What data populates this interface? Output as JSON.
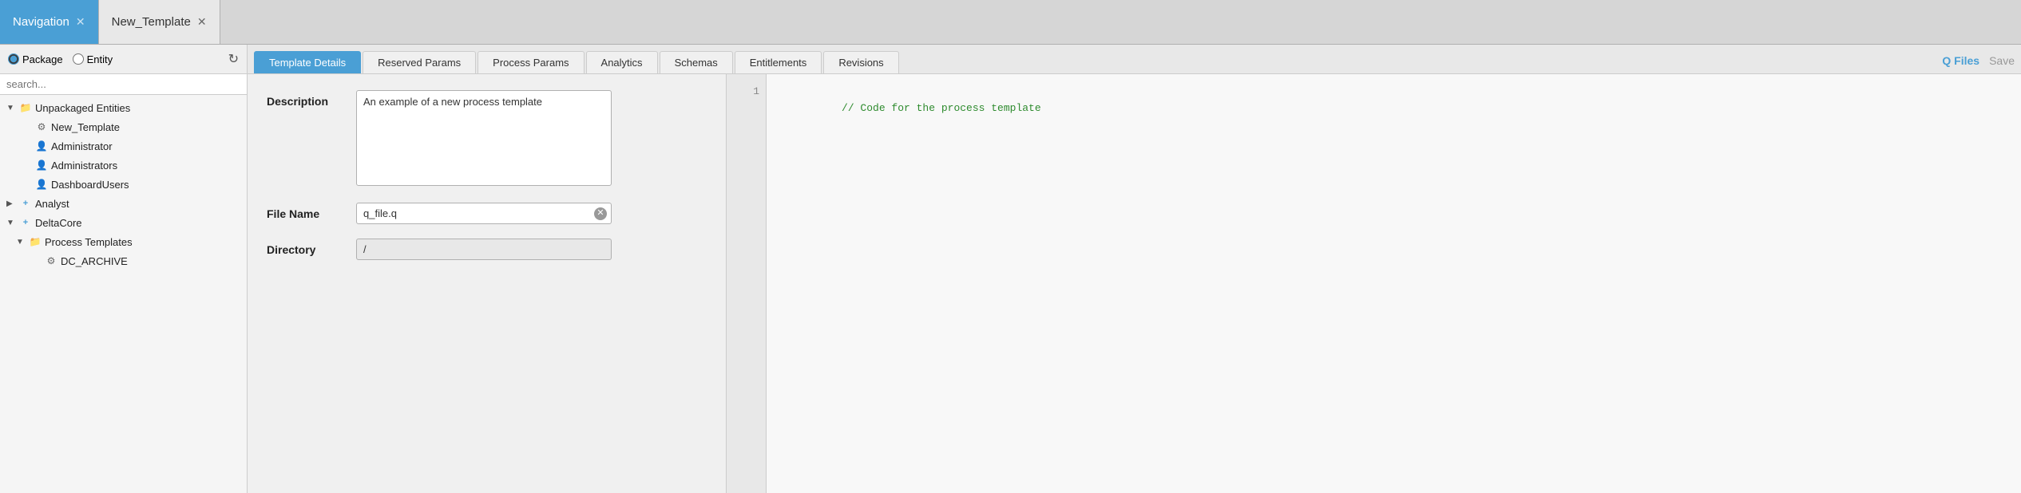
{
  "tabs": [
    {
      "id": "navigation",
      "label": "Navigation",
      "active": true,
      "closable": true
    },
    {
      "id": "new-template",
      "label": "New_Template",
      "active": true,
      "closable": true
    }
  ],
  "sidebar": {
    "radio_package_label": "Package",
    "radio_entity_label": "Entity",
    "search_placeholder": "search...",
    "refresh_icon": "↻",
    "tree": [
      {
        "id": "unpackaged",
        "label": "Unpackaged Entities",
        "level": 0,
        "type": "folder",
        "expanded": true,
        "arrow": "▼"
      },
      {
        "id": "new-template",
        "label": "New_Template",
        "level": 1,
        "type": "gear",
        "arrow": ""
      },
      {
        "id": "administrator",
        "label": "Administrator",
        "level": 1,
        "type": "user",
        "arrow": ""
      },
      {
        "id": "administrators",
        "label": "Administrators",
        "level": 1,
        "type": "user",
        "arrow": ""
      },
      {
        "id": "dashboardusers",
        "label": "DashboardUsers",
        "level": 1,
        "type": "user",
        "arrow": ""
      },
      {
        "id": "analyst",
        "label": "Analyst",
        "level": 0,
        "type": "plus-folder",
        "expanded": false,
        "arrow": "▶"
      },
      {
        "id": "deltacore",
        "label": "DeltaCore",
        "level": 0,
        "type": "plus-folder",
        "expanded": true,
        "arrow": "▼"
      },
      {
        "id": "process-templates",
        "label": "Process Templates",
        "level": 1,
        "type": "folder",
        "expanded": true,
        "arrow": "▼"
      },
      {
        "id": "dc-archive",
        "label": "DC_ARCHIVE",
        "level": 2,
        "type": "gear",
        "arrow": ""
      }
    ]
  },
  "sub_tabs": [
    {
      "id": "template-details",
      "label": "Template Details",
      "active": true
    },
    {
      "id": "reserved-params",
      "label": "Reserved Params",
      "active": false
    },
    {
      "id": "process-params",
      "label": "Process Params",
      "active": false
    },
    {
      "id": "analytics",
      "label": "Analytics",
      "active": false
    },
    {
      "id": "schemas",
      "label": "Schemas",
      "active": false
    },
    {
      "id": "entitlements",
      "label": "Entitlements",
      "active": false
    },
    {
      "id": "revisions",
      "label": "Revisions",
      "active": false
    }
  ],
  "actions": {
    "q_files_label": "Q Files",
    "save_label": "Save"
  },
  "form": {
    "description_label": "Description",
    "description_value": "An example of a new process template",
    "filename_label": "File Name",
    "filename_value": "q_file.q",
    "directory_label": "Directory",
    "directory_value": "/"
  },
  "code_editor": {
    "line_numbers": [
      "1"
    ],
    "code_lines": [
      "// Code for the process template"
    ]
  }
}
